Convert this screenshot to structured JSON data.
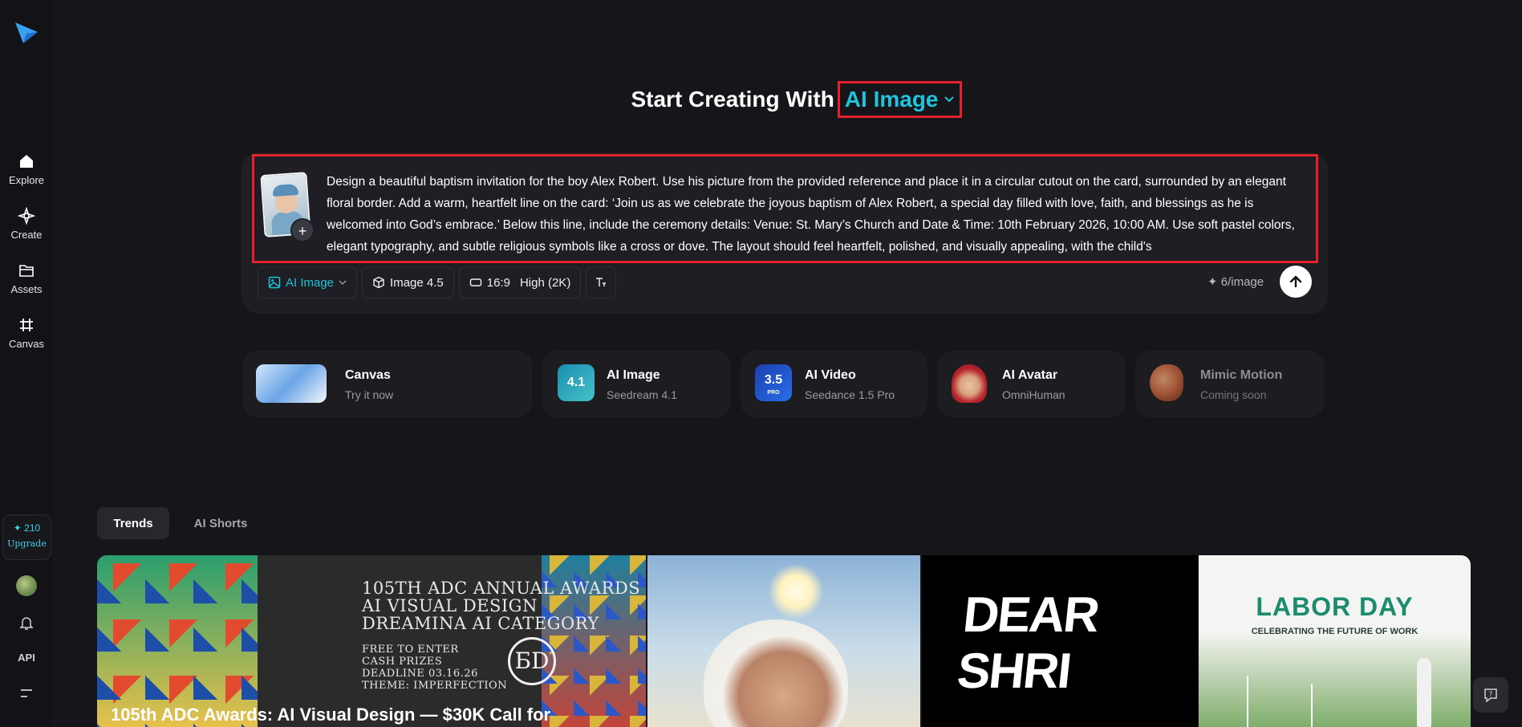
{
  "sidebar": {
    "logo": "dreamina-logo-icon",
    "items": [
      {
        "label": "Explore",
        "icon": "home-icon"
      },
      {
        "label": "Create",
        "icon": "sparkle-icon"
      },
      {
        "label": "Assets",
        "icon": "folder-icon"
      },
      {
        "label": "Canvas",
        "icon": "canvas-grid-icon"
      }
    ],
    "credits": "✦ 210",
    "upgrade_label": "Upgrade",
    "api_label": "API"
  },
  "header": {
    "prefix": "Start Creating With",
    "model": "AI Image"
  },
  "prompt": {
    "text": "Design a beautiful baptism invitation for the boy Alex Robert. Use his picture from the provided reference and place it in a circular cutout on the card, surrounded by an elegant floral border. Add a warm, heartfelt line on the card: ‘Join us as we celebrate the joyous baptism of Alex Robert, a special day filled with love, faith, and blessings as he is welcomed into God’s embrace.’ Below this line, include the ceremony details: Venue: St. Mary’s Church and Date & Time: 10th February 2026, 10:00 AM. Use soft pastel colors, elegant typography, and subtle religious symbols like a cross or dove. The layout should feel heartfelt, polished, and visually appealing, with the child's",
    "add_symbol": "+"
  },
  "toolbar": {
    "mode": "AI Image",
    "model_version": "Image 4.5",
    "ratio": "16:9",
    "quality": "High (2K)",
    "cost": "✦ 6/image"
  },
  "features": [
    {
      "title": "Canvas",
      "subtitle": "Try it now"
    },
    {
      "title": "AI Image",
      "subtitle": "Seedream 4.1",
      "badge": "4.1"
    },
    {
      "title": "AI Video",
      "subtitle": "Seedance 1.5 Pro",
      "badge": "3.5",
      "badge_sub": "PRO"
    },
    {
      "title": "AI Avatar",
      "subtitle": "OmniHuman"
    },
    {
      "title": "Mimic Motion",
      "subtitle": "Coming soon"
    }
  ],
  "tabs": [
    "Trends",
    "AI Shorts"
  ],
  "gallery": {
    "card1": {
      "poster_lines": [
        "105TH ADC ANNUAL AWARDS",
        "AI VISUAL DESIGN",
        "DREAMINA AI CATEGORY"
      ],
      "poster_details": [
        "FREE TO ENTER",
        "CASH PRIZES",
        "DEADLINE 03.16.26",
        "THEME: IMPERFECTION"
      ],
      "logo_text": "ƂD",
      "caption": "105th ADC Awards: AI Visual Design — $30K Call for"
    },
    "card3": {
      "poster_text": [
        "DEAR",
        "SHRI"
      ]
    },
    "card4": {
      "title": "LABOR DAY",
      "subtitle": "CELEBRATING THE FUTURE OF WORK"
    }
  },
  "colors": {
    "accent": "#1fc3da",
    "highlight": "#e3222d",
    "background": "#15151a"
  }
}
